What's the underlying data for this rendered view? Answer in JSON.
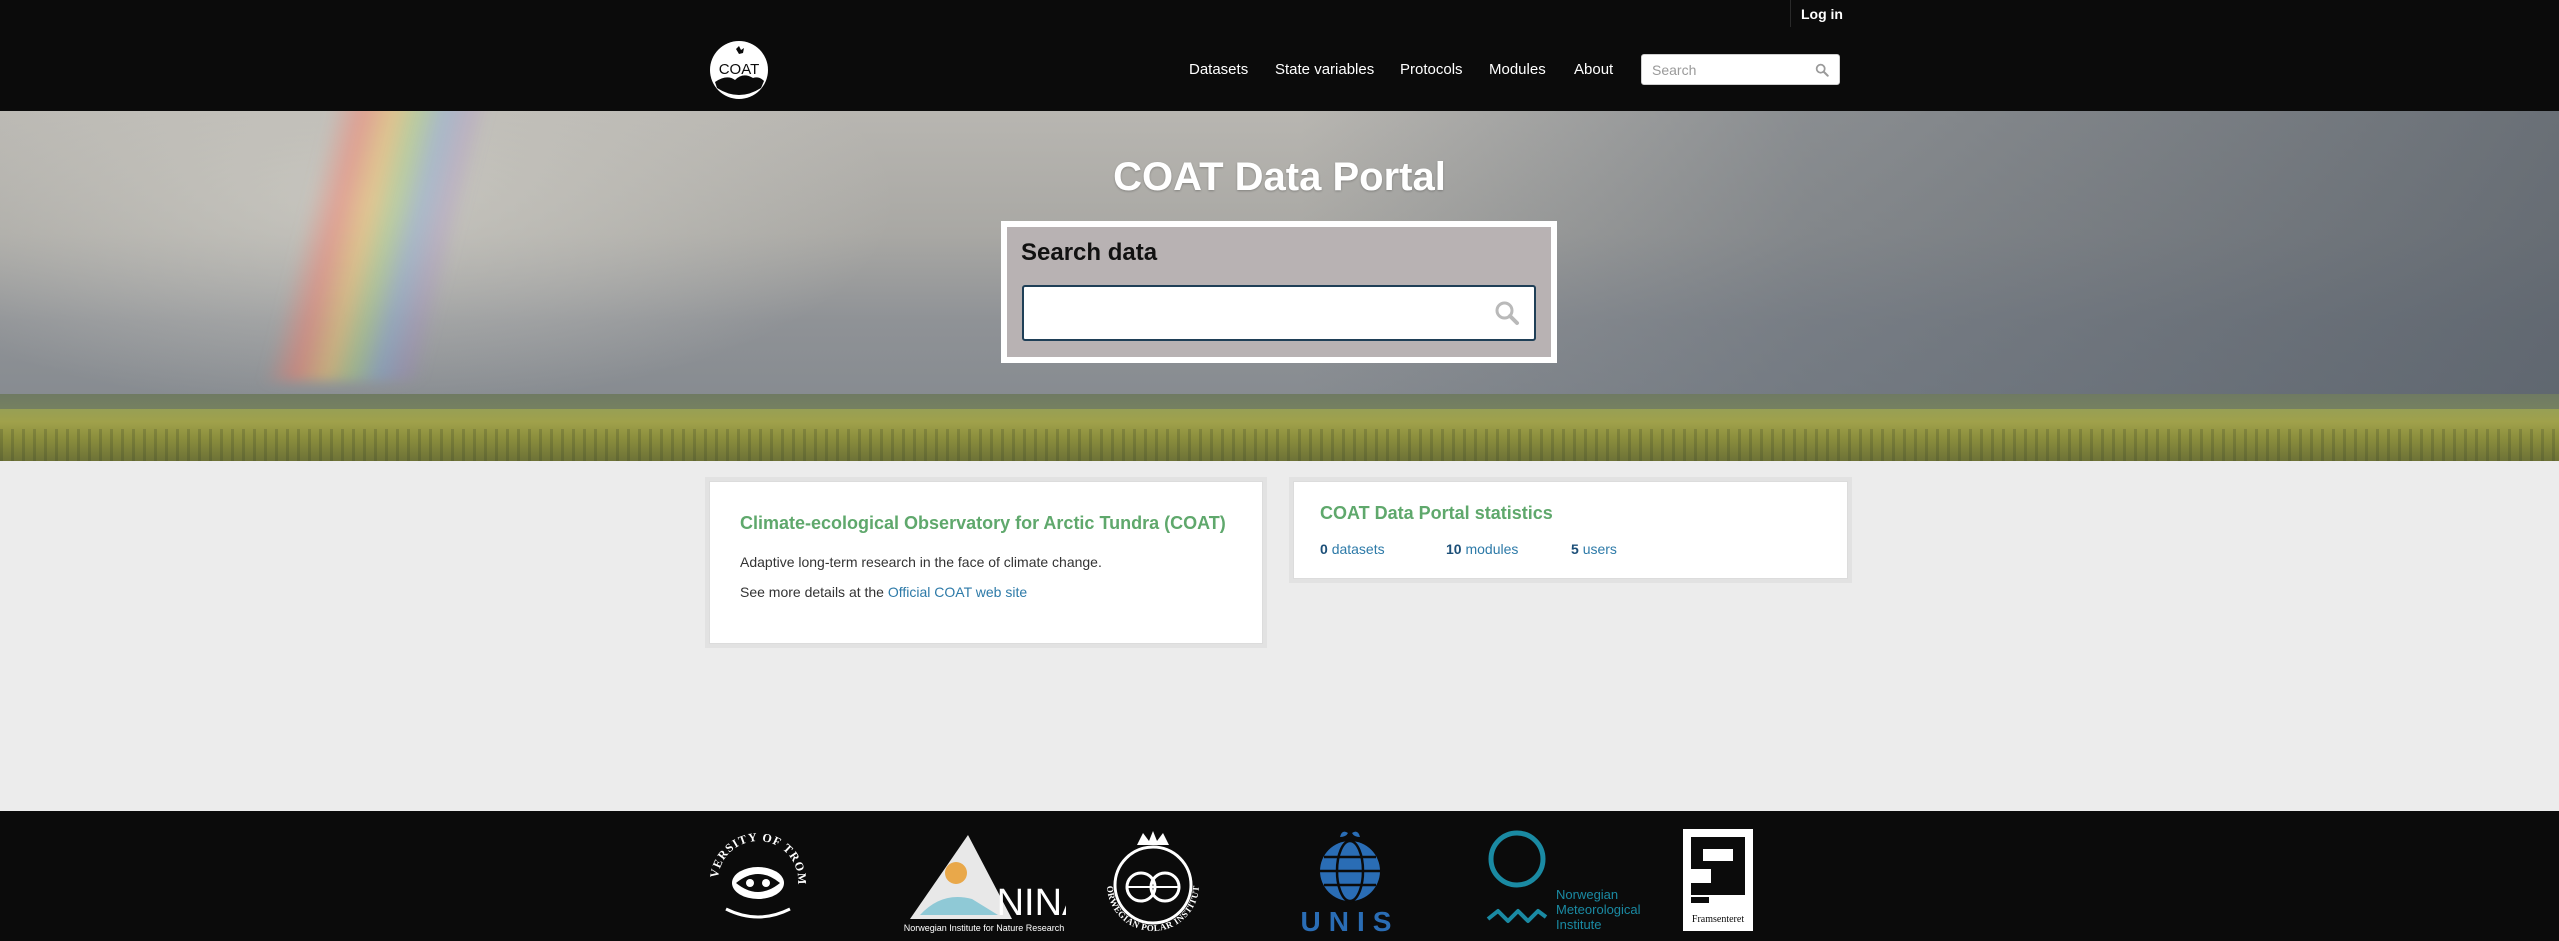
{
  "header": {
    "login_label": "Log in",
    "logo_text": "COAT",
    "nav": [
      {
        "label": "Datasets"
      },
      {
        "label": "State variables"
      },
      {
        "label": "Protocols"
      },
      {
        "label": "Modules"
      },
      {
        "label": "About"
      }
    ],
    "search": {
      "placeholder": "Search"
    }
  },
  "hero": {
    "title": "COAT Data Portal",
    "search_heading": "Search data",
    "search_value": ""
  },
  "intro_card": {
    "title": "Climate-ecological Observatory for Arctic Tundra (COAT)",
    "description": "Adaptive long-term research in the face of climate change.",
    "more_prefix": "See more details at the ",
    "more_link": "Official COAT web site"
  },
  "stats_card": {
    "title": "COAT Data Portal statistics",
    "datasets": {
      "count": "0",
      "label": "datasets"
    },
    "modules": {
      "count": "10",
      "label": "modules"
    },
    "users": {
      "count": "5",
      "label": "users"
    }
  },
  "footer": {
    "partners": {
      "uit": {
        "text": "UNIVERSITY OF TROMSØ"
      },
      "nina": {
        "name": "NINA",
        "caption": "Norwegian Institute for Nature Research"
      },
      "npi": {
        "text": "NORWEGIAN POLAR INSTITUTE"
      },
      "unis": {
        "name": "UNIS"
      },
      "met": {
        "line1": "Norwegian",
        "line2": "Meteorological",
        "line3": "Institute"
      },
      "fram": {
        "caption": "Framsenteret"
      }
    }
  },
  "colors": {
    "masthead_bg": "#0b0b0b",
    "accent_green": "#5fa86c",
    "link_blue": "#2d7aa8",
    "search_panel": "#b8b2b3",
    "met_teal": "#1a8aa3",
    "unis_blue": "#2a6db5"
  },
  "icons": [
    "coat-logo",
    "search-icon"
  ]
}
